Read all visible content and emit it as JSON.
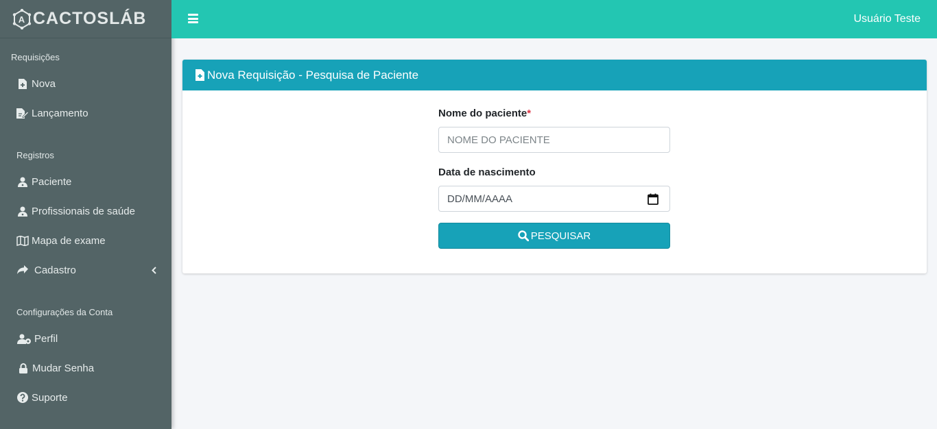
{
  "brand": {
    "name": "CACTOSLÁB"
  },
  "topbar": {
    "user_name": "Usuário Teste"
  },
  "sidebar": {
    "sections": [
      {
        "title": "Requisições",
        "items": [
          {
            "label": "Nova",
            "icon": "file-plus-icon"
          },
          {
            "label": "Lançamento",
            "icon": "edit-file-icon"
          }
        ]
      },
      {
        "title": "Registros",
        "items": [
          {
            "label": "Paciente",
            "icon": "user-doctor-icon"
          },
          {
            "label": "Profissionais de saúde",
            "icon": "user-doctor-icon"
          },
          {
            "label": "Mapa de exame",
            "icon": "map-icon"
          },
          {
            "label": "Cadastro",
            "icon": "share-arrow-icon"
          }
        ]
      },
      {
        "title": "Configurações da Conta",
        "items": [
          {
            "label": "Perfil",
            "icon": "user-gear-icon"
          },
          {
            "label": "Mudar Senha",
            "icon": "lock-icon"
          },
          {
            "label": "Suporte",
            "icon": "question-circle-icon"
          }
        ]
      }
    ]
  },
  "card": {
    "title": "Nova Requisição - Pesquisa de Paciente",
    "patient_name_label": "Nome do paciente",
    "required_mark": "*",
    "patient_name_placeholder": "NOME DO PACIENTE",
    "birth_date_label": "Data de nascimento",
    "birth_date_value": "DD/MM/AAAA",
    "search_button_label": "PESQUISAR"
  },
  "colors": {
    "sidebar": "#536466",
    "topbar": "#23c6b2",
    "primary": "#17a2b8",
    "background": "#f4f6f9",
    "required": "#dc3545"
  }
}
